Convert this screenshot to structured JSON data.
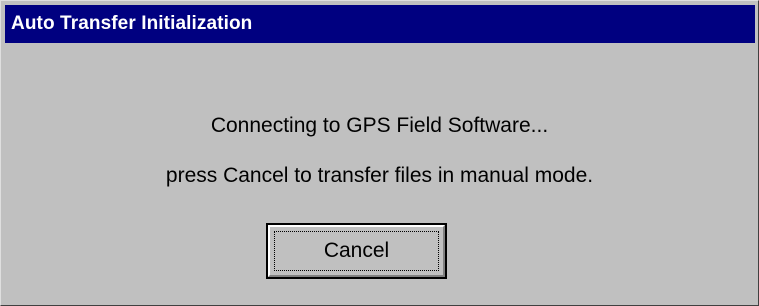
{
  "window": {
    "title": "Auto Transfer Initialization"
  },
  "message": {
    "line1": "Connecting to GPS Field Software...",
    "line2": "press Cancel to transfer files in manual mode."
  },
  "buttons": {
    "cancel_label": "Cancel"
  },
  "colors": {
    "titlebar_bg": "#000080",
    "titlebar_text": "#ffffff",
    "dialog_bg": "#c0c0c0"
  }
}
